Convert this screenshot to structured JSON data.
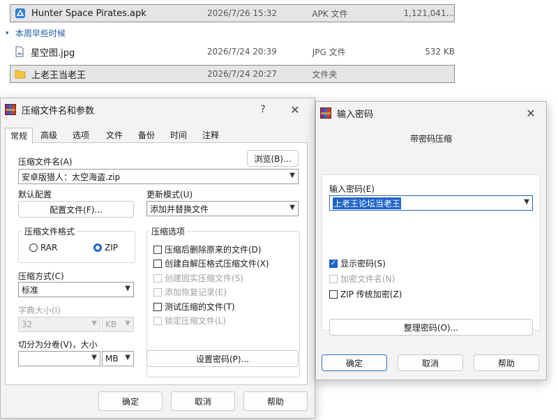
{
  "explorer": {
    "files": [
      {
        "name": "Hunter Space Pirates.apk",
        "date": "2026/7/26 15:32",
        "type": "APK 文件",
        "size": "1,121,041...",
        "icon": "apk-icon",
        "selected": true
      },
      {
        "name": "星空图.jpg",
        "date": "2026/7/24 20:39",
        "type": "JPG 文件",
        "size": "532 KB",
        "icon": "image-file-icon",
        "selected": false
      },
      {
        "name": "上老王当老王",
        "date": "2026/7/24 20:27",
        "type": "文件夹",
        "size": "",
        "icon": "folder-icon",
        "selected": true
      }
    ],
    "group_label": "本周早些时候"
  },
  "archive_dialog": {
    "title": "压缩文件名和参数",
    "help_symbol": "?",
    "close_symbol": "✕",
    "tabs": [
      "常规",
      "高级",
      "选项",
      "文件",
      "备份",
      "时间",
      "注释"
    ],
    "archive_name_label": "压缩文件名(A)",
    "browse_button": "浏览(B)...",
    "archive_name_value": "安卓版猎人：太空海盗.zip",
    "profile_label": "默认配置",
    "profile_button": "配置文件(F)...",
    "update_mode_label": "更新模式(U)",
    "update_mode_value": "添加并替换文件",
    "format_group": "压缩文件格式",
    "format_rar": "RAR",
    "format_zip": "ZIP",
    "options_group": "压缩选项",
    "options": [
      {
        "label": "压缩后删除原来的文件(D)",
        "checked": false,
        "disabled": false
      },
      {
        "label": "创建自解压格式压缩文件(X)",
        "checked": false,
        "disabled": false
      },
      {
        "label": "创建固实压缩文件(S)",
        "checked": false,
        "disabled": true
      },
      {
        "label": "添加恢复记录(E)",
        "checked": false,
        "disabled": true
      },
      {
        "label": "测试压缩的文件(T)",
        "checked": false,
        "disabled": false
      },
      {
        "label": "锁定压缩文件(L)",
        "checked": false,
        "disabled": true
      }
    ],
    "method_label": "压缩方式(C)",
    "method_value": "标准",
    "dict_label": "字典大小(I)",
    "dict_value": "32",
    "dict_unit": "KB",
    "split_label": "切分为分卷(V)，大小",
    "split_value": "",
    "split_unit": "MB",
    "set_password_button": "设置密码(P)...",
    "ok": "确定",
    "cancel": "取消",
    "help": "帮助"
  },
  "password_dialog": {
    "title": "输入密码",
    "close_symbol": "✕",
    "heading": "带密码压缩",
    "enter_label": "输入密码(E)",
    "password_value": "上老王论坛当老王",
    "show_password": "显示密码(S)",
    "encrypt_names": "加密文件名(N)",
    "zip_legacy": "ZIP 传统加密(Z)",
    "organize_button": "整理密码(O)...",
    "ok": "确定",
    "cancel": "取消",
    "help": "帮助"
  },
  "colors": {
    "accent": "#1f63c6",
    "selection": "#e5e5e5",
    "dialog_bg": "#f3f3f3"
  }
}
